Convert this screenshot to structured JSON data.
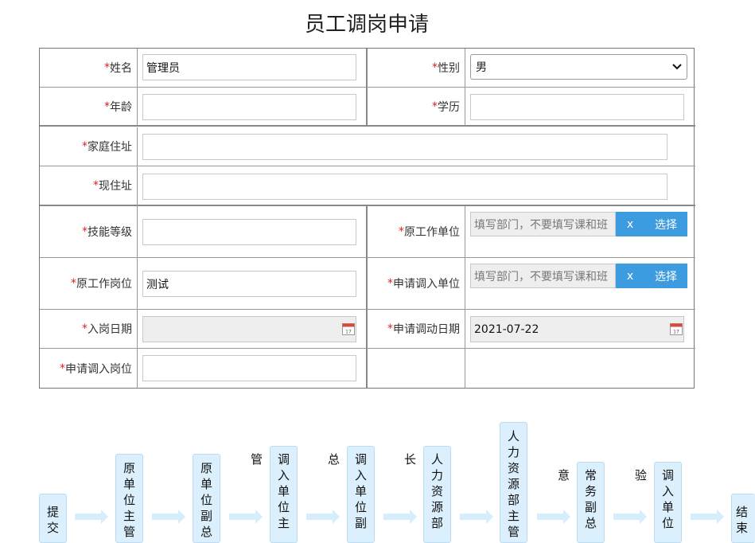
{
  "title": "员工调岗申请",
  "form": {
    "required_mark": "*",
    "name_label": "姓名",
    "name_value": "管理员",
    "gender_label": "性别",
    "gender_value": "男",
    "age_label": "年龄",
    "age_value": "",
    "education_label": "学历",
    "education_value": "",
    "home_address_label": "家庭住址",
    "home_address_value": "",
    "current_address_label": "现住址",
    "current_address_value": "",
    "skill_level_label": "技能等级",
    "skill_level_value": "",
    "orig_unit_label": "原工作单位",
    "orig_unit_placeholder": "填写部门，不要填写课和班",
    "orig_position_label": "原工作岗位",
    "orig_position_value": "测试",
    "target_unit_label": "申请调入单位",
    "target_unit_placeholder": "填写部门，不要填写课和班",
    "entry_date_label": "入岗日期",
    "entry_date_value": "",
    "transfer_date_label": "申请调动日期",
    "transfer_date_value": "2021-07-22",
    "target_position_label": "申请调入岗位",
    "target_position_value": "",
    "clear_label": "x",
    "choose_label": "选择",
    "calendar_day": "17"
  },
  "flow": {
    "nodes": [
      "提交",
      "原单位主管",
      "原单位副总",
      "调入单位主管",
      "调入单位副总",
      "人力资源部长",
      "人力资源部主管",
      "常务副总意",
      "调入单位验",
      "结束"
    ]
  }
}
